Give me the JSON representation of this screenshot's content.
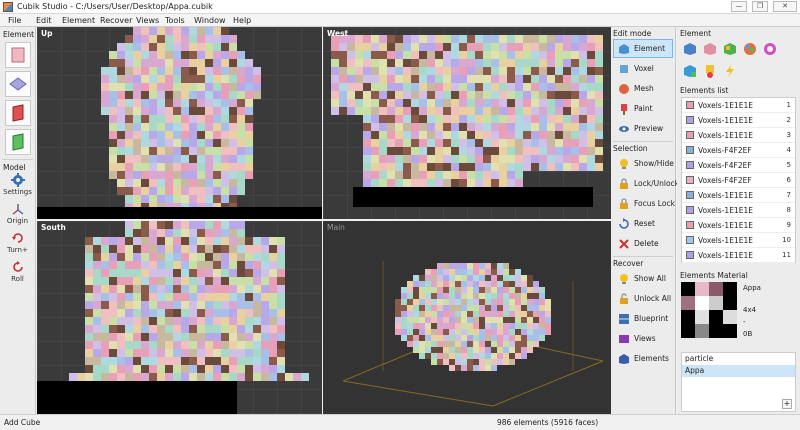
{
  "window": {
    "title": "Cubik Studio - C:/Users/User/Desktop/Appa.cubik",
    "minimize": "—",
    "maximize": "❐",
    "close": "✕"
  },
  "menu": [
    "File",
    "Edit",
    "Element",
    "Recover",
    "Views",
    "Tools",
    "Window",
    "Help"
  ],
  "left_panel": {
    "element_title": "Element",
    "model_title": "Model",
    "model_tools": [
      {
        "label": "Settings",
        "icon": "gear-icon"
      },
      {
        "label": "Origin",
        "icon": "origin-axes-icon"
      },
      {
        "label": "Turn+",
        "icon": "rotate-icon"
      },
      {
        "label": "Roll",
        "icon": "roll-icon"
      }
    ]
  },
  "viewports": {
    "up": "Up",
    "west": "West",
    "south": "South",
    "main": "Main"
  },
  "edit_mode": {
    "title": "Edit mode",
    "items": [
      "Element",
      "Voxel",
      "Mesh",
      "Paint",
      "Preview"
    ],
    "active": "Element"
  },
  "selection": {
    "title": "Selection",
    "items": [
      "Show/Hide",
      "Lock/Unlock",
      "Focus Lock",
      "Reset",
      "Delete"
    ]
  },
  "recover": {
    "title": "Recover",
    "items": [
      "Show All",
      "Unlock All",
      "Blueprint",
      "Views",
      "Elements"
    ]
  },
  "element_panel": {
    "title": "Element"
  },
  "elements_list": {
    "title": "Elements list",
    "rows": [
      {
        "name": "Voxels-1E1E1E",
        "num": "1",
        "color": "#e8a0b0"
      },
      {
        "name": "Voxels-1E1E1E",
        "num": "2",
        "color": "#b0a0e8"
      },
      {
        "name": "Voxels-1E1E1E",
        "num": "3",
        "color": "#e8a0b0"
      },
      {
        "name": "Voxels-F4F2EF",
        "num": "4",
        "color": "#8ab0d8"
      },
      {
        "name": "Voxels-F4F2EF",
        "num": "5",
        "color": "#b0a0e8"
      },
      {
        "name": "Voxels-F4F2EF",
        "num": "6",
        "color": "#e8b0c0"
      },
      {
        "name": "Voxels-1E1E1E",
        "num": "7",
        "color": "#8ab0d8"
      },
      {
        "name": "Voxels-1E1E1E",
        "num": "8",
        "color": "#b0a0e8"
      },
      {
        "name": "Voxels-1E1E1E",
        "num": "9",
        "color": "#e8a0b0"
      },
      {
        "name": "Voxels-1E1E1E",
        "num": "10",
        "color": "#a0c8e8"
      },
      {
        "name": "Voxels-1E1E1E",
        "num": "11",
        "color": "#b0a0e8"
      }
    ]
  },
  "elements_material": {
    "title": "Elements Material",
    "name": "Appa",
    "size": "4x4",
    "dash": "-",
    "bytes": "0B"
  },
  "particle": {
    "header": "particle",
    "items": [
      "Appa"
    ],
    "plus": "+"
  },
  "status": {
    "left": "Add Cube",
    "count": "986 elements (5916 faces)"
  }
}
